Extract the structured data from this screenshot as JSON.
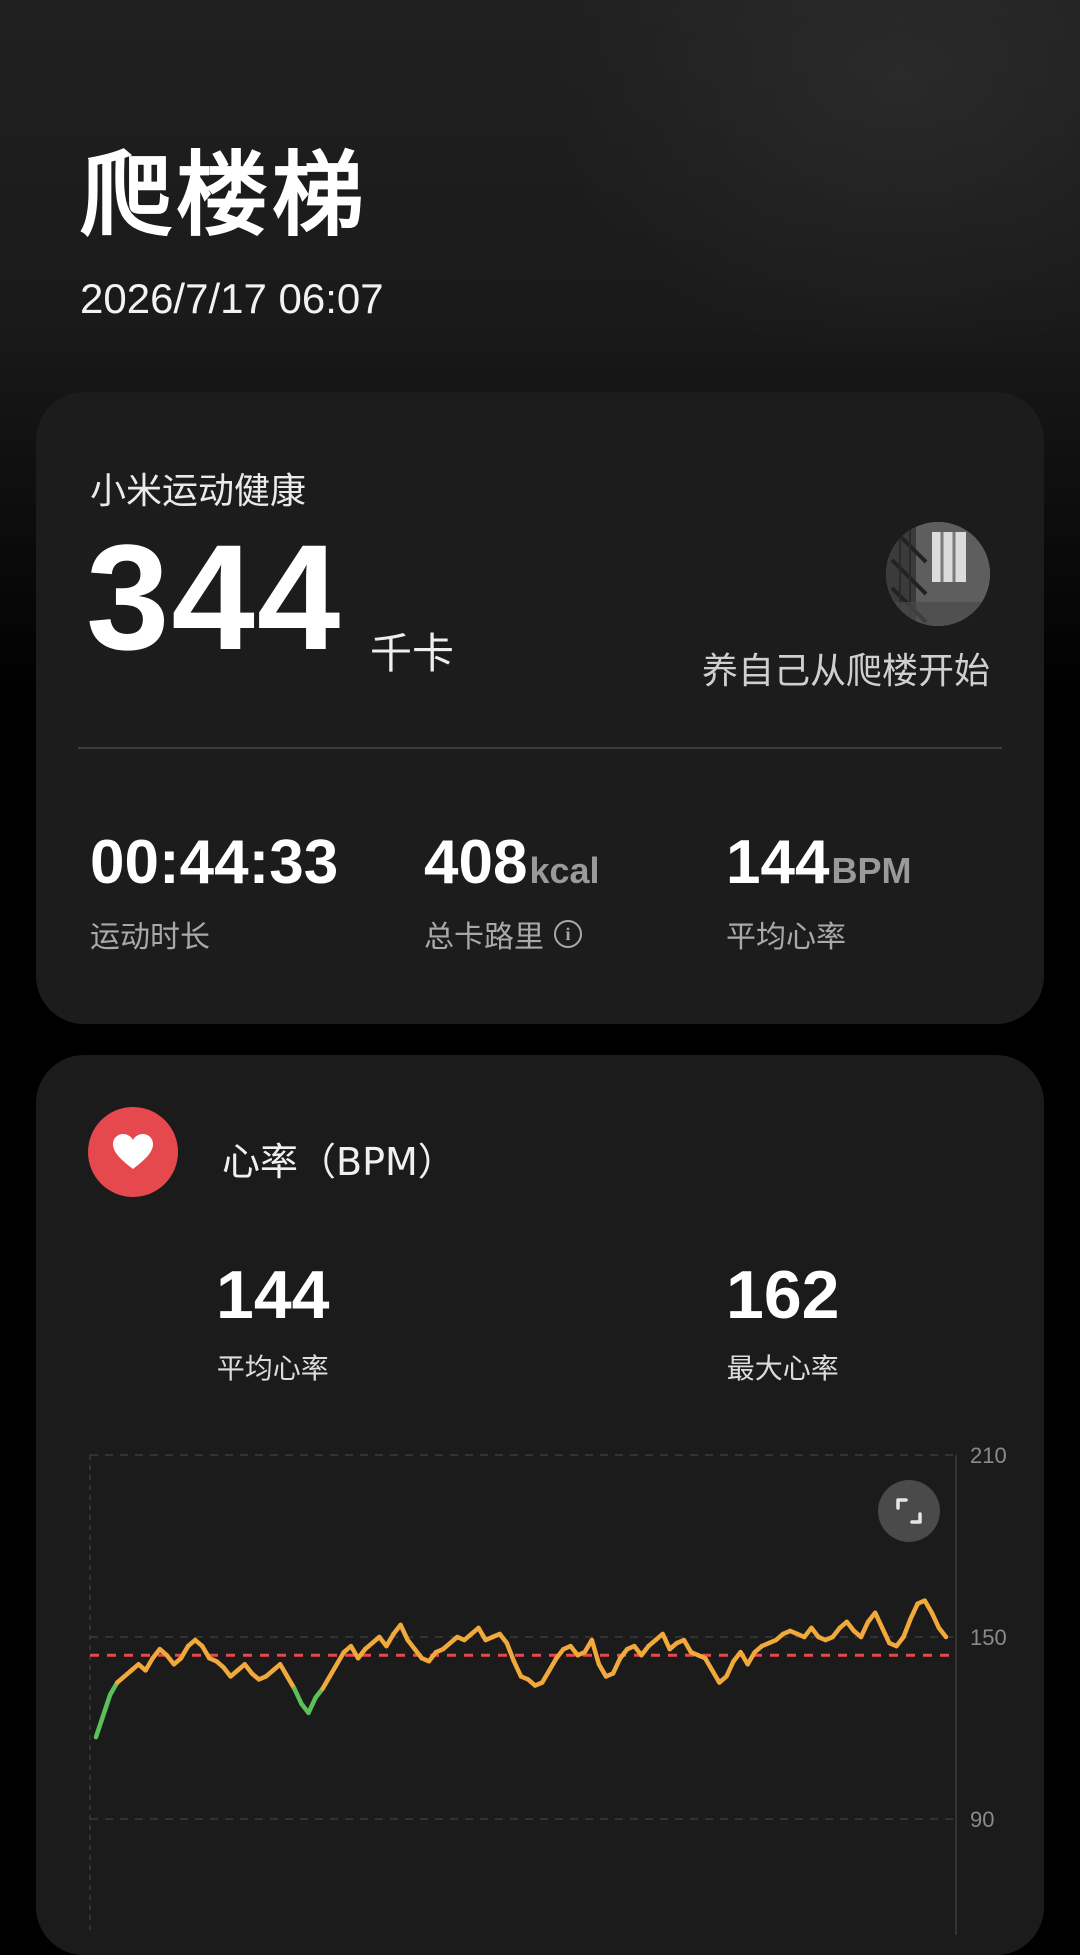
{
  "header": {
    "title": "爬楼梯",
    "datetime": "2026/7/17 06:07"
  },
  "summary": {
    "brand": "小米运动健康",
    "calories_value": "344",
    "calories_unit": "千卡",
    "slogan": "养自己从爬楼开始",
    "stats": [
      {
        "value": "00:44:33",
        "unit": "",
        "label": "运动时长"
      },
      {
        "value": "408",
        "unit": "kcal",
        "label": "总卡路里"
      },
      {
        "value": "144",
        "unit": "BPM",
        "label": "平均心率"
      }
    ]
  },
  "heart_rate": {
    "title": "心率（BPM）",
    "avg_value": "144",
    "avg_label": "平均心率",
    "max_value": "162",
    "max_label": "最大心率"
  },
  "colors": {
    "accent_red": "#e5484d",
    "line_orange": "#f0a93a",
    "line_green": "#5cc15a",
    "avg_line": "#e5484d"
  },
  "icons": [
    "heart-icon",
    "info-icon",
    "expand-icon"
  ],
  "chart_data": {
    "type": "line",
    "yticks": [
      "210",
      "150",
      "90"
    ],
    "ylim": [
      90,
      210
    ],
    "avg_reference": 144,
    "series": [
      {
        "values": [
          117,
          124,
          131,
          135,
          137,
          139,
          141,
          139,
          143,
          146,
          144,
          141,
          143,
          147,
          149,
          147,
          143,
          142,
          140,
          137,
          139,
          141,
          138,
          136,
          137,
          139,
          141,
          137,
          133,
          128,
          125,
          130,
          133,
          137,
          141,
          145,
          147,
          143,
          146,
          148,
          150,
          147,
          151,
          154,
          149,
          146,
          143,
          142,
          145,
          146,
          148,
          150,
          149,
          151,
          153,
          149,
          150,
          151,
          148,
          142,
          137,
          136,
          134,
          135,
          139,
          143,
          146,
          147,
          144,
          145,
          149,
          141,
          137,
          138,
          143,
          146,
          147,
          144,
          147,
          149,
          151,
          146,
          148,
          149,
          145,
          144,
          143,
          139,
          135,
          137,
          142,
          145,
          141,
          145,
          147,
          148,
          149,
          151,
          152,
          151,
          150,
          153,
          150,
          149,
          150,
          153,
          155,
          152,
          150,
          155,
          158,
          153,
          148,
          147,
          150,
          156,
          161,
          162,
          158,
          153,
          150
        ]
      }
    ]
  }
}
